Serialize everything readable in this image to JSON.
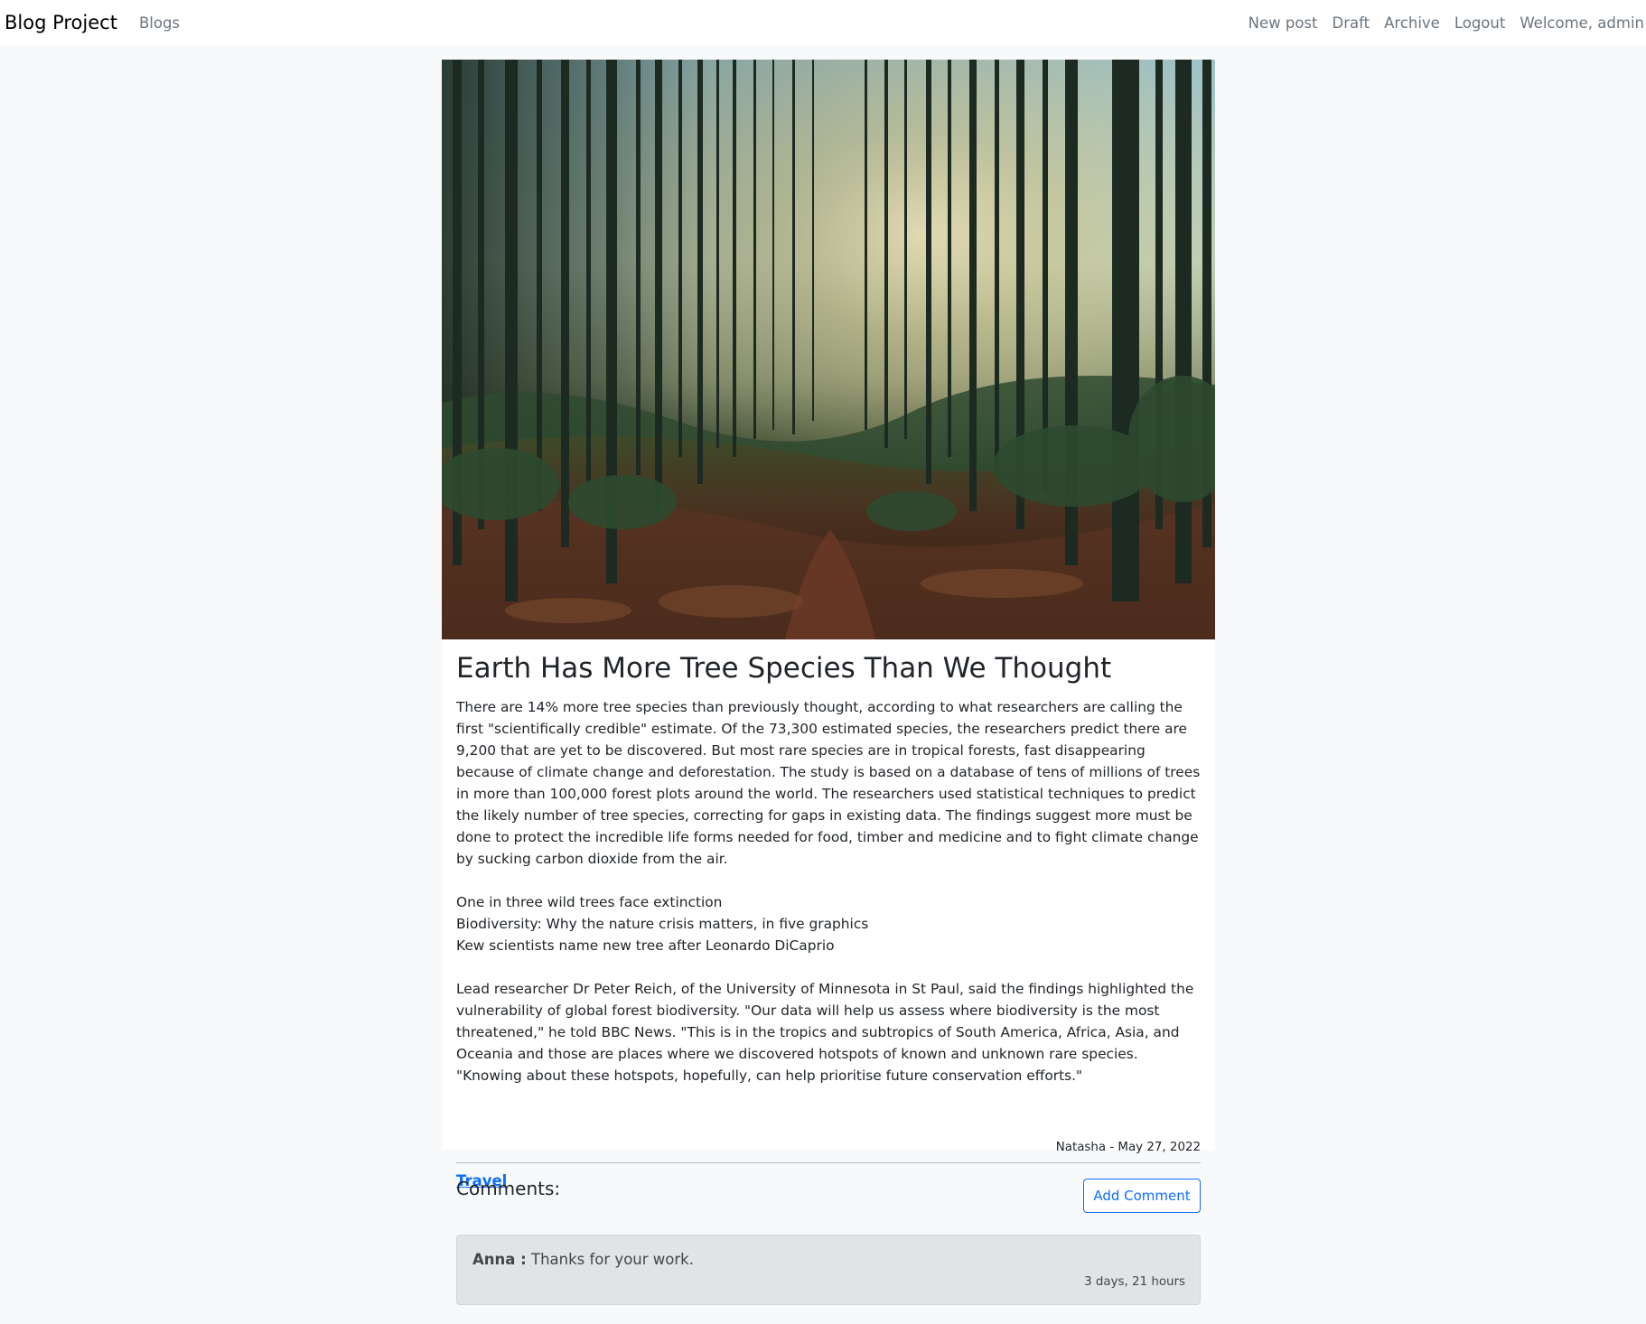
{
  "navbar": {
    "brand": "Blog Project",
    "left_links": [
      "Blogs"
    ],
    "right_links": [
      "New post",
      "Draft",
      "Archive",
      "Logout"
    ],
    "welcome": "Welcome, admin"
  },
  "post": {
    "image_alt": "forest-with-sunlight",
    "title": "Earth Has More Tree Species Than We Thought",
    "body": "There are 14% more tree species than previously thought, according to what researchers are calling the first \"scientifically credible\" estimate. Of the 73,300 estimated species, the researchers predict there are 9,200 that are yet to be discovered. But most rare species are in tropical forests, fast disappearing because of climate change and deforestation. The study is based on a database of tens of millions of trees in more than 100,000 forest plots around the world. The researchers used statistical techniques to predict the likely number of tree species, correcting for gaps in existing data. The findings suggest more must be done to protect the incredible life forms needed for food, timber and medicine and to fight climate change by sucking carbon dioxide from the air.\n\nOne in three wild trees face extinction\nBiodiversity: Why the nature crisis matters, in five graphics\nKew scientists name new tree after Leonardo DiCaprio\n\nLead researcher Dr Peter Reich, of the University of Minnesota in St Paul, said the findings highlighted the vulnerability of global forest biodiversity. \"Our data will help us assess where biodiversity is the most threatened,\" he told BBC News. \"This is in the tropics and subtropics of South America, Africa, Asia, and Oceania and those are places where we discovered hotspots of known and unknown rare species. \"Knowing about these hotspots, hopefully, can help prioritise future conservation efforts.\"",
    "meta": "Natasha - May 27, 2022",
    "tag": "Travel"
  },
  "comments": {
    "heading": "Comments:",
    "add_button": "Add Comment",
    "items": [
      {
        "author": "Anna :",
        "text": " Thanks for your work.",
        "time": "3 days, 21 hours"
      }
    ]
  },
  "colors": {
    "primary": "#0d6efd",
    "page_bg": "#f8f9fa",
    "muted": "#6c757d",
    "comment_bg": "#e2e3e5"
  }
}
